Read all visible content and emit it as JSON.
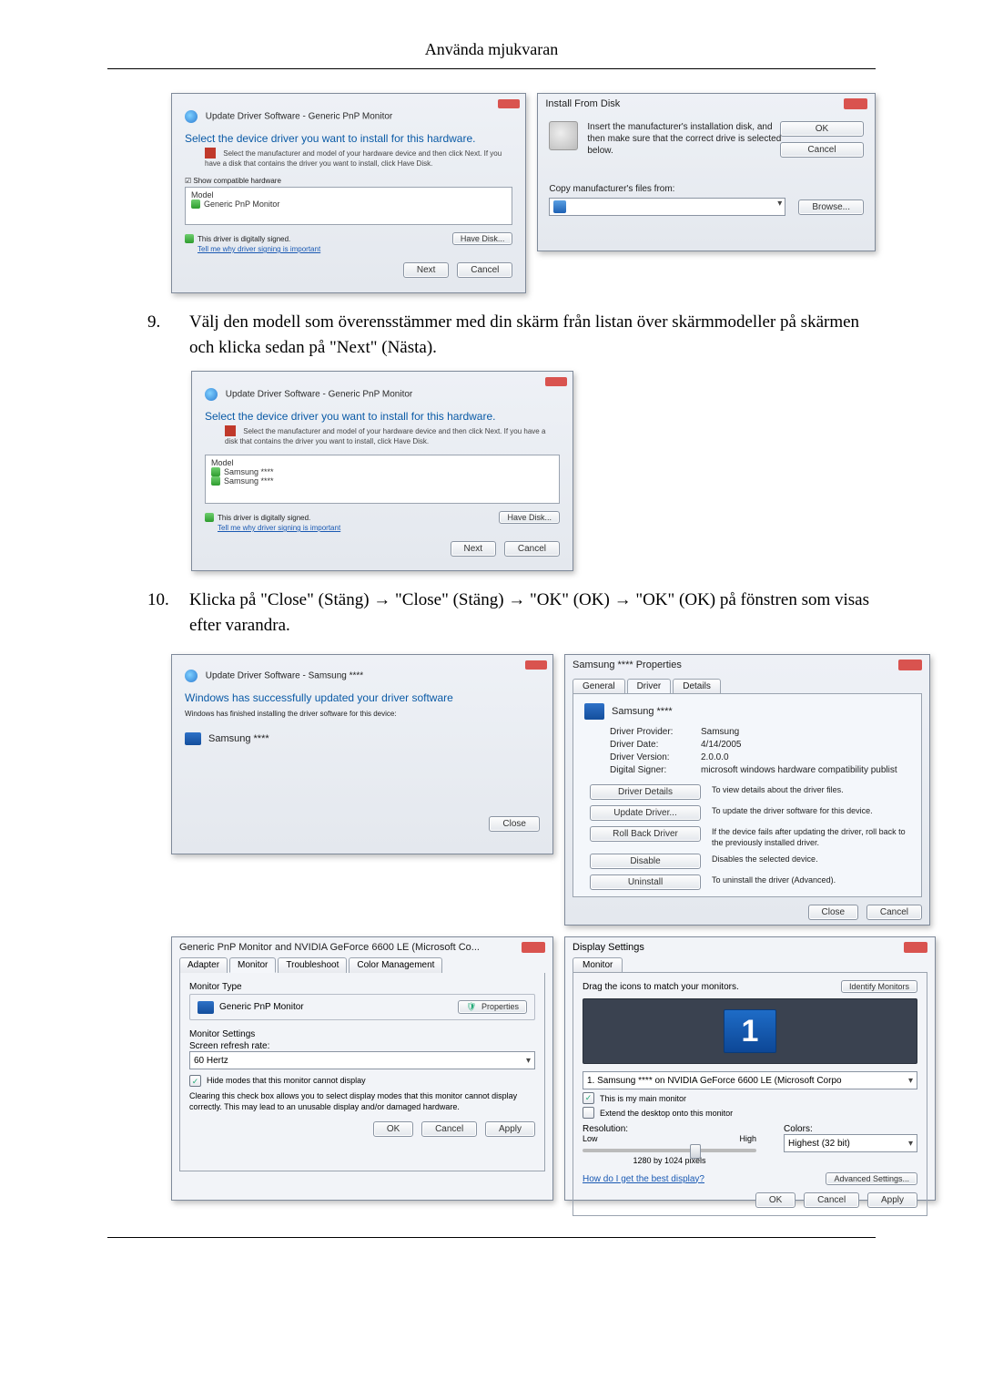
{
  "header": {
    "title": "Använda mjukvaran"
  },
  "updateDriver1": {
    "crumb": "Update Driver Software - Generic PnP Monitor",
    "headline": "Select the device driver you want to install for this hardware.",
    "sub": "Select the manufacturer and model of your hardware device and then click Next. If you have a disk that contains the driver you want to install, click Have Disk.",
    "compat": "☑ Show compatible hardware",
    "col": "Model",
    "item": "Generic PnP Monitor",
    "signed": "This driver is digitally signed.",
    "link": "Tell me why driver signing is important",
    "haveDisk": "Have Disk...",
    "next": "Next",
    "cancel": "Cancel"
  },
  "installFromDisk": {
    "title": "Install From Disk",
    "msg": "Insert the manufacturer's installation disk, and then make sure that the correct drive is selected below.",
    "ok": "OK",
    "cancel": "Cancel",
    "copy": "Copy manufacturer's files from:",
    "browse": "Browse..."
  },
  "step9": {
    "num": "9.",
    "text": "Välj den modell som överensstämmer med din skärm från listan över skärmmodeller på skärmen och klicka sedan på \"Next\" (Nästa)."
  },
  "updateDriver2": {
    "crumb": "Update Driver Software - Generic PnP Monitor",
    "headline": "Select the device driver you want to install for this hardware.",
    "sub": "Select the manufacturer and model of your hardware device and then click Next. If you have a disk that contains the driver you want to install, click Have Disk.",
    "col": "Model",
    "item1": "Samsung ****",
    "item2": "Samsung ****",
    "signed": "This driver is digitally signed.",
    "link": "Tell me why driver signing is important",
    "haveDisk": "Have Disk...",
    "next": "Next",
    "cancel": "Cancel"
  },
  "step10": {
    "num": "10.",
    "text": "Klicka på \"Close\" (Stäng) → \"Close\" (Stäng) → \"OK\" (OK) → \"OK\" (OK) på fönstren som visas efter varandra."
  },
  "success": {
    "crumb": "Update Driver Software - Samsung ****",
    "headline": "Windows has successfully updated your driver software",
    "sub": "Windows has finished installing the driver software for this device:",
    "device": "Samsung ****",
    "close": "Close"
  },
  "props": {
    "title": "Samsung **** Properties",
    "tabGeneral": "General",
    "tabDriver": "Driver",
    "tabDetails": "Details",
    "device": "Samsung ****",
    "kProvider": "Driver Provider:",
    "vProvider": "Samsung",
    "kDate": "Driver Date:",
    "vDate": "4/14/2005",
    "kVersion": "Driver Version:",
    "vVersion": "2.0.0.0",
    "kSigner": "Digital Signer:",
    "vSigner": "microsoft windows hardware compatibility publist",
    "bDetails": "Driver Details",
    "dDetails": "To view details about the driver files.",
    "bUpdate": "Update Driver...",
    "dUpdate": "To update the driver software for this device.",
    "bRoll": "Roll Back Driver",
    "dRoll": "If the device fails after updating the driver, roll back to the previously installed driver.",
    "bDisable": "Disable",
    "dDisable": "Disables the selected device.",
    "bUninstall": "Uninstall",
    "dUninstall": "To uninstall the driver (Advanced).",
    "close": "Close",
    "cancel": "Cancel"
  },
  "monp": {
    "title": "Generic PnP Monitor and NVIDIA GeForce 6600 LE (Microsoft Co...",
    "tabAdapter": "Adapter",
    "tabMonitor": "Monitor",
    "tabTrouble": "Troubleshoot",
    "tabColor": "Color Management",
    "grpType": "Monitor Type",
    "monName": "Generic PnP Monitor",
    "propsBtn": "Properties",
    "grpSet": "Monitor Settings",
    "refreshLab": "Screen refresh rate:",
    "refreshVal": "60 Hertz",
    "hide": "Hide modes that this monitor cannot display",
    "hideDesc": "Clearing this check box allows you to select display modes that this monitor cannot display correctly. This may lead to an unusable display and/or damaged hardware.",
    "ok": "OK",
    "cancel": "Cancel",
    "apply": "Apply"
  },
  "disp": {
    "title": "Display Settings",
    "tab": "Monitor",
    "drag": "Drag the icons to match your monitors.",
    "identify": "Identify Monitors",
    "monNum": "1",
    "selected": "1. Samsung **** on NVIDIA GeForce 6600 LE (Microsoft Corpo",
    "main": "This is my main monitor",
    "extend": "Extend the desktop onto this monitor",
    "resLab": "Resolution:",
    "low": "Low",
    "high": "High",
    "resVal": "1280 by 1024 pixels",
    "colLab": "Colors:",
    "colVal": "Highest (32 bit)",
    "best": "How do I get the best display?",
    "adv": "Advanced Settings...",
    "ok": "OK",
    "cancel": "Cancel",
    "apply": "Apply"
  }
}
